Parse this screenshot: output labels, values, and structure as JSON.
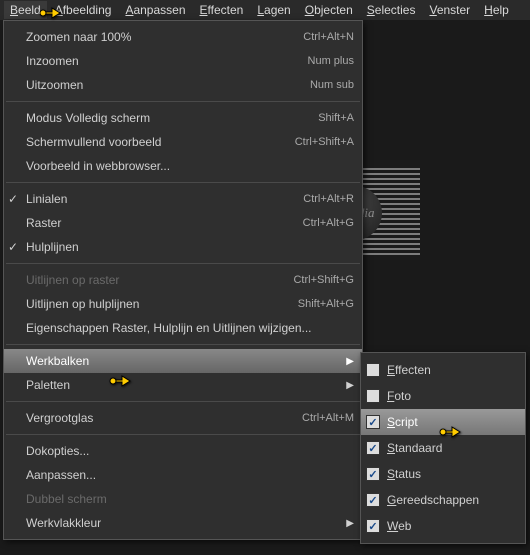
{
  "menubar": [
    {
      "label": "Beeld",
      "accel": "B",
      "active": true
    },
    {
      "label": "Afbeelding",
      "accel": "A"
    },
    {
      "label": "Aanpassen",
      "accel": "A"
    },
    {
      "label": "Effecten",
      "accel": "E"
    },
    {
      "label": "Lagen",
      "accel": "L"
    },
    {
      "label": "Objecten",
      "accel": "O"
    },
    {
      "label": "Selecties",
      "accel": "S"
    },
    {
      "label": "Venster",
      "accel": "V"
    },
    {
      "label": "Help",
      "accel": "H"
    }
  ],
  "menu": {
    "items": [
      {
        "label": "Zoomen naar 100%",
        "shortcut": "Ctrl+Alt+N"
      },
      {
        "label": "Inzoomen",
        "shortcut": "Num plus"
      },
      {
        "label": "Uitzoomen",
        "shortcut": "Num sub"
      },
      {
        "sep": true
      },
      {
        "label": "Modus Volledig scherm",
        "shortcut": "Shift+A"
      },
      {
        "label": "Schermvullend voorbeeld",
        "shortcut": "Ctrl+Shift+A"
      },
      {
        "label": "Voorbeeld in webbrowser...",
        "shortcut": ""
      },
      {
        "sep": true
      },
      {
        "label": "Linialen",
        "shortcut": "Ctrl+Alt+R",
        "checked": true
      },
      {
        "label": "Raster",
        "shortcut": "Ctrl+Alt+G"
      },
      {
        "label": "Hulplijnen",
        "shortcut": "",
        "checked": true
      },
      {
        "sep": true
      },
      {
        "label": "Uitlijnen op raster",
        "shortcut": "Ctrl+Shift+G",
        "disabled": true
      },
      {
        "label": "Uitlijnen op hulplijnen",
        "shortcut": "Shift+Alt+G"
      },
      {
        "label": "Eigenschappen Raster, Hulplijn en Uitlijnen wijzigen...",
        "shortcut": ""
      },
      {
        "sep": true
      },
      {
        "label": "Werkbalken",
        "shortcut": "",
        "submenu": true,
        "highlight": true
      },
      {
        "label": "Paletten",
        "shortcut": "",
        "submenu": true
      },
      {
        "sep": true
      },
      {
        "label": "Vergrootglas",
        "shortcut": "Ctrl+Alt+M"
      },
      {
        "sep": true
      },
      {
        "label": "Dokopties...",
        "shortcut": ""
      },
      {
        "label": "Aanpassen...",
        "shortcut": ""
      },
      {
        "label": "Dubbel scherm",
        "shortcut": "",
        "disabled": true
      },
      {
        "label": "Werkvlakkleur",
        "shortcut": "",
        "submenu": true
      }
    ]
  },
  "submenu": {
    "items": [
      {
        "label": "Effecten",
        "accel": "E"
      },
      {
        "label": "Foto",
        "accel": "F"
      },
      {
        "label": "Script",
        "accel": "S",
        "checked": true,
        "highlight": true
      },
      {
        "label": "Standaard",
        "accel": "S",
        "checked": true
      },
      {
        "label": "Status",
        "accel": "S",
        "checked": true
      },
      {
        "label": "Gereedschappen",
        "accel": "G",
        "checked": true
      },
      {
        "label": "Web",
        "accel": "W",
        "checked": true
      }
    ]
  },
  "watermark_text": "claudia"
}
